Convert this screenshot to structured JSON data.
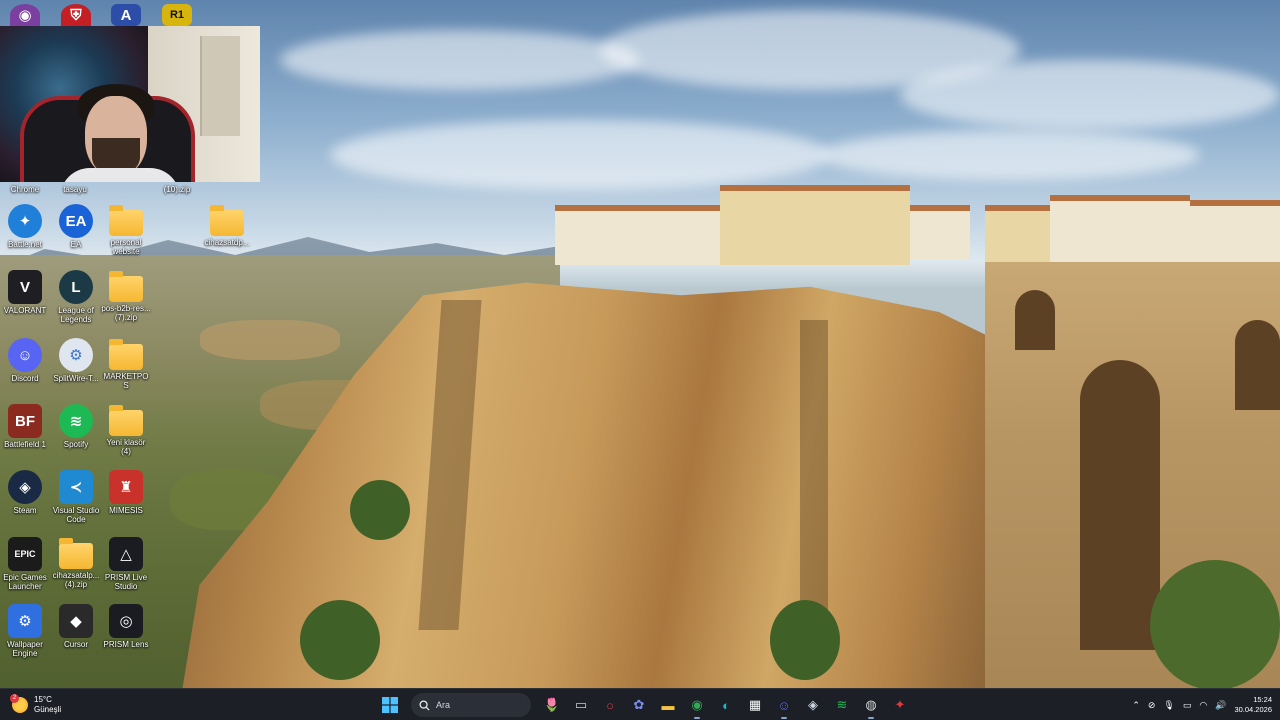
{
  "top_row_icons": [
    {
      "name": "github-desktop-icon",
      "glyph": "◉",
      "color": "#7b3fa0"
    },
    {
      "name": "mcd-launcher-icon",
      "glyph": "⛨",
      "color": "#c41f25"
    },
    {
      "name": "altium-icon",
      "glyph": "A",
      "color": "#2c4ea8"
    },
    {
      "name": "r1-icon",
      "glyph": "R1",
      "color": "#d8b40f"
    }
  ],
  "webcam_labels": {
    "chrome": "Chrome",
    "tasayu": "tasayu",
    "zip": "(10).zip"
  },
  "desktop_icons": [
    {
      "name": "battlenet-icon",
      "label": "Battle.net",
      "glyph": "✦",
      "color": "#1f7fd9",
      "round": true
    },
    {
      "name": "ea-icon",
      "label": "EA",
      "glyph": "EA",
      "color": "#1a63d6",
      "round": true
    },
    {
      "name": "folder-icon",
      "label": "personal website",
      "folder": true
    },
    {
      "name": "folder-icon",
      "label": "cihazsatdp...",
      "folder": true
    },
    {
      "name": "valorant-icon",
      "label": "VALORANT",
      "glyph": "V",
      "color": "#1f1f23"
    },
    {
      "name": "league-icon",
      "label": "League of Legends",
      "glyph": "L",
      "color": "#1c3a45",
      "round": true
    },
    {
      "name": "zip-folder-icon",
      "label": "pos-b2b-res... (7).zip",
      "folder": true
    },
    {
      "name": "discord-icon",
      "label": "Discord",
      "glyph": "☺",
      "color": "#5865f2",
      "round": true
    },
    {
      "name": "splitwire-icon",
      "label": "SplitWire-T...",
      "glyph": "⚙",
      "color": "#dfe6ef",
      "round": true
    },
    {
      "name": "folder-icon",
      "label": "MARKETPOS",
      "folder": true
    },
    {
      "name": "battlefield-icon",
      "label": "Battlefield 1",
      "glyph": "BF",
      "color": "#8b2b20"
    },
    {
      "name": "spotify-icon",
      "label": "Spotify",
      "glyph": "≋",
      "color": "#1db954",
      "round": true
    },
    {
      "name": "folder-icon",
      "label": "Yeni klasör (4)",
      "folder": true
    },
    {
      "name": "steam-icon",
      "label": "Steam",
      "glyph": "◈",
      "color": "#1a2a44",
      "round": true
    },
    {
      "name": "vscode-icon",
      "label": "Visual Studio Code",
      "glyph": "≺",
      "color": "#1f8ad2"
    },
    {
      "name": "mimesis-icon",
      "label": "MIMESIS",
      "glyph": "♜",
      "color": "#c8322b"
    },
    {
      "name": "epic-games-icon",
      "label": "Epic Games Launcher",
      "glyph": "EPIC",
      "color": "#1b1b1b"
    },
    {
      "name": "zip-folder-icon",
      "label": "cihazsatalp... (4).zip",
      "folder": true
    },
    {
      "name": "prism-live-icon",
      "label": "PRISM Live Studio",
      "glyph": "△",
      "color": "#1b1b22"
    },
    {
      "name": "wallpaper-engine-icon",
      "label": "Wallpaper Engine",
      "glyph": "⚙",
      "color": "#2f6fe0"
    },
    {
      "name": "cursor-icon",
      "label": "Cursor",
      "glyph": "◆",
      "color": "#2a2a2a"
    },
    {
      "name": "prism-lens-icon",
      "label": "PRISM Lens",
      "glyph": "◎",
      "color": "#1b1b22"
    }
  ],
  "taskbar": {
    "weather": {
      "temp": "15°C",
      "condition": "Güneşli",
      "badge": "2"
    },
    "search_placeholder": "Ara",
    "apps": [
      {
        "name": "widgets-icon",
        "glyph": "🌷",
        "color": "#e76a8b"
      },
      {
        "name": "file-explorer-mini-icon",
        "glyph": "▭",
        "color": "#c8ccd4"
      },
      {
        "name": "opera-icon",
        "glyph": "○",
        "color": "#e0383e"
      },
      {
        "name": "copilot-icon",
        "glyph": "✿",
        "color": "#7b8ef0"
      },
      {
        "name": "file-explorer-icon",
        "glyph": "▬",
        "color": "#f5c342"
      },
      {
        "name": "chrome-icon",
        "glyph": "◉",
        "color": "#34a853",
        "active": true
      },
      {
        "name": "edge-icon",
        "glyph": "◐",
        "color": "#1eb8c7"
      },
      {
        "name": "store-icon",
        "glyph": "▦",
        "color": "#ffffff"
      },
      {
        "name": "discord-icon",
        "glyph": "☺",
        "color": "#5865f2",
        "active": true
      },
      {
        "name": "steam-icon",
        "glyph": "◈",
        "color": "#c7d5e0"
      },
      {
        "name": "spotify-icon",
        "glyph": "≋",
        "color": "#1db954"
      },
      {
        "name": "obs-icon",
        "glyph": "◍",
        "color": "#d5d5d5",
        "active": true
      },
      {
        "name": "app-red-icon",
        "glyph": "✦",
        "color": "#e0383e"
      }
    ],
    "tray": {
      "time": "15:24",
      "date": "30.04.2026"
    }
  }
}
